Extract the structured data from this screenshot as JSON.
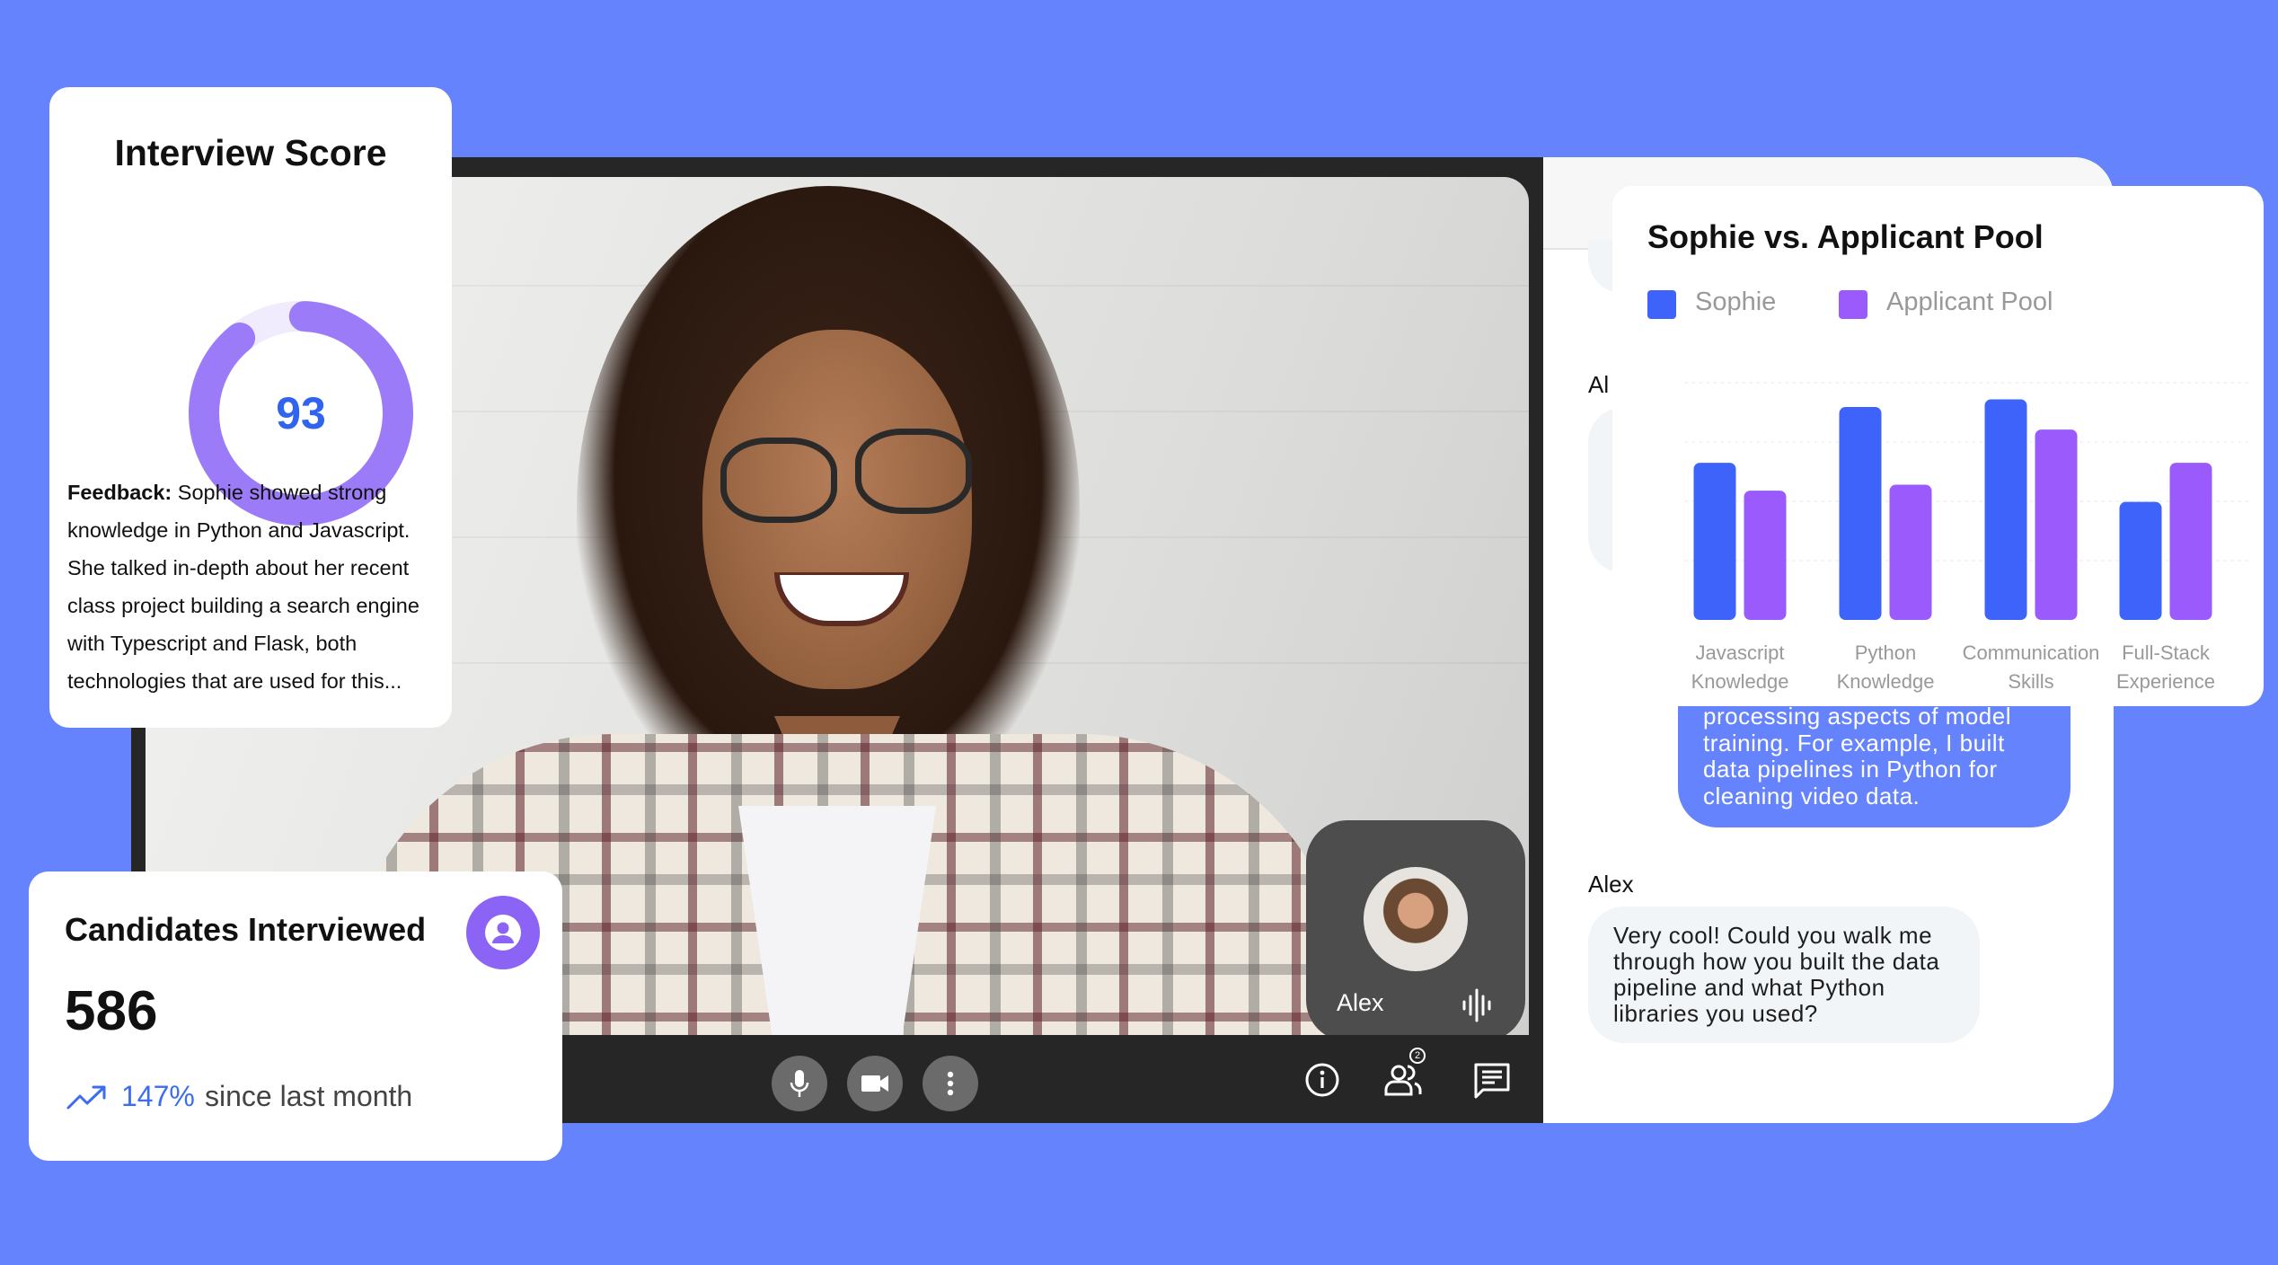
{
  "video": {
    "self_view": {
      "name": "Alex"
    },
    "controls": {
      "mic": "microphone-icon",
      "camera": "video-camera-icon",
      "more": "more-vertical-icon",
      "info": "info-icon",
      "participants": "people-icon",
      "participants_count": "2",
      "chat": "chat-icon"
    }
  },
  "transcript": {
    "hidden_speaker": "Al",
    "candidate_message_lines": [
      "processing aspects of model",
      "training. For example, I built",
      "data pipelines in Python for",
      "cleaning video data."
    ],
    "interviewer": {
      "name": "Alex",
      "message_lines": [
        "Very cool! Could you walk me",
        "through how you built the data",
        "pipeline and what Python",
        "libraries you used?"
      ]
    }
  },
  "score_card": {
    "title": "Interview Score",
    "score": "93",
    "score_value": 93,
    "score_max": 100,
    "feedback_label": "Feedback:",
    "feedback_text": "Sophie showed strong knowledge in Python and Javascript. She talked in-depth about her recent class project building a search engine with Typescript and Flask, both technologies that are used for this...",
    "colors": {
      "ring": "#9b7bf7",
      "track": "#f1ebfe",
      "score": "#2f63f0"
    }
  },
  "candidates_card": {
    "title": "Candidates Interviewed",
    "count": "586",
    "change": "147%",
    "change_label": "since last month",
    "icon": "user-circle-icon",
    "trend_icon": "trending-up-icon"
  },
  "chart_data": {
    "type": "bar",
    "title": "Sophie vs. Applicant Pool",
    "categories": [
      [
        "Javascript",
        "Knowledge"
      ],
      [
        "Python",
        "Knowledge"
      ],
      [
        "Communication",
        "Skills"
      ],
      [
        "Full-Stack",
        "Experience"
      ]
    ],
    "series": [
      {
        "name": "Sophie",
        "color": "#3d63fb",
        "values": [
          2.65,
          3.59,
          3.72,
          1.99
        ]
      },
      {
        "name": "Applicant Pool",
        "color": "#9a5afc",
        "values": [
          2.18,
          2.28,
          3.21,
          2.65
        ]
      }
    ],
    "ylim": [
      0,
      4
    ],
    "grid": true,
    "legend": "top-left",
    "xlabel": "",
    "ylabel": ""
  },
  "colors": {
    "background": "#6683fe",
    "accent_purple": "#8b63f5",
    "accent_blue": "#3c6cf0"
  }
}
